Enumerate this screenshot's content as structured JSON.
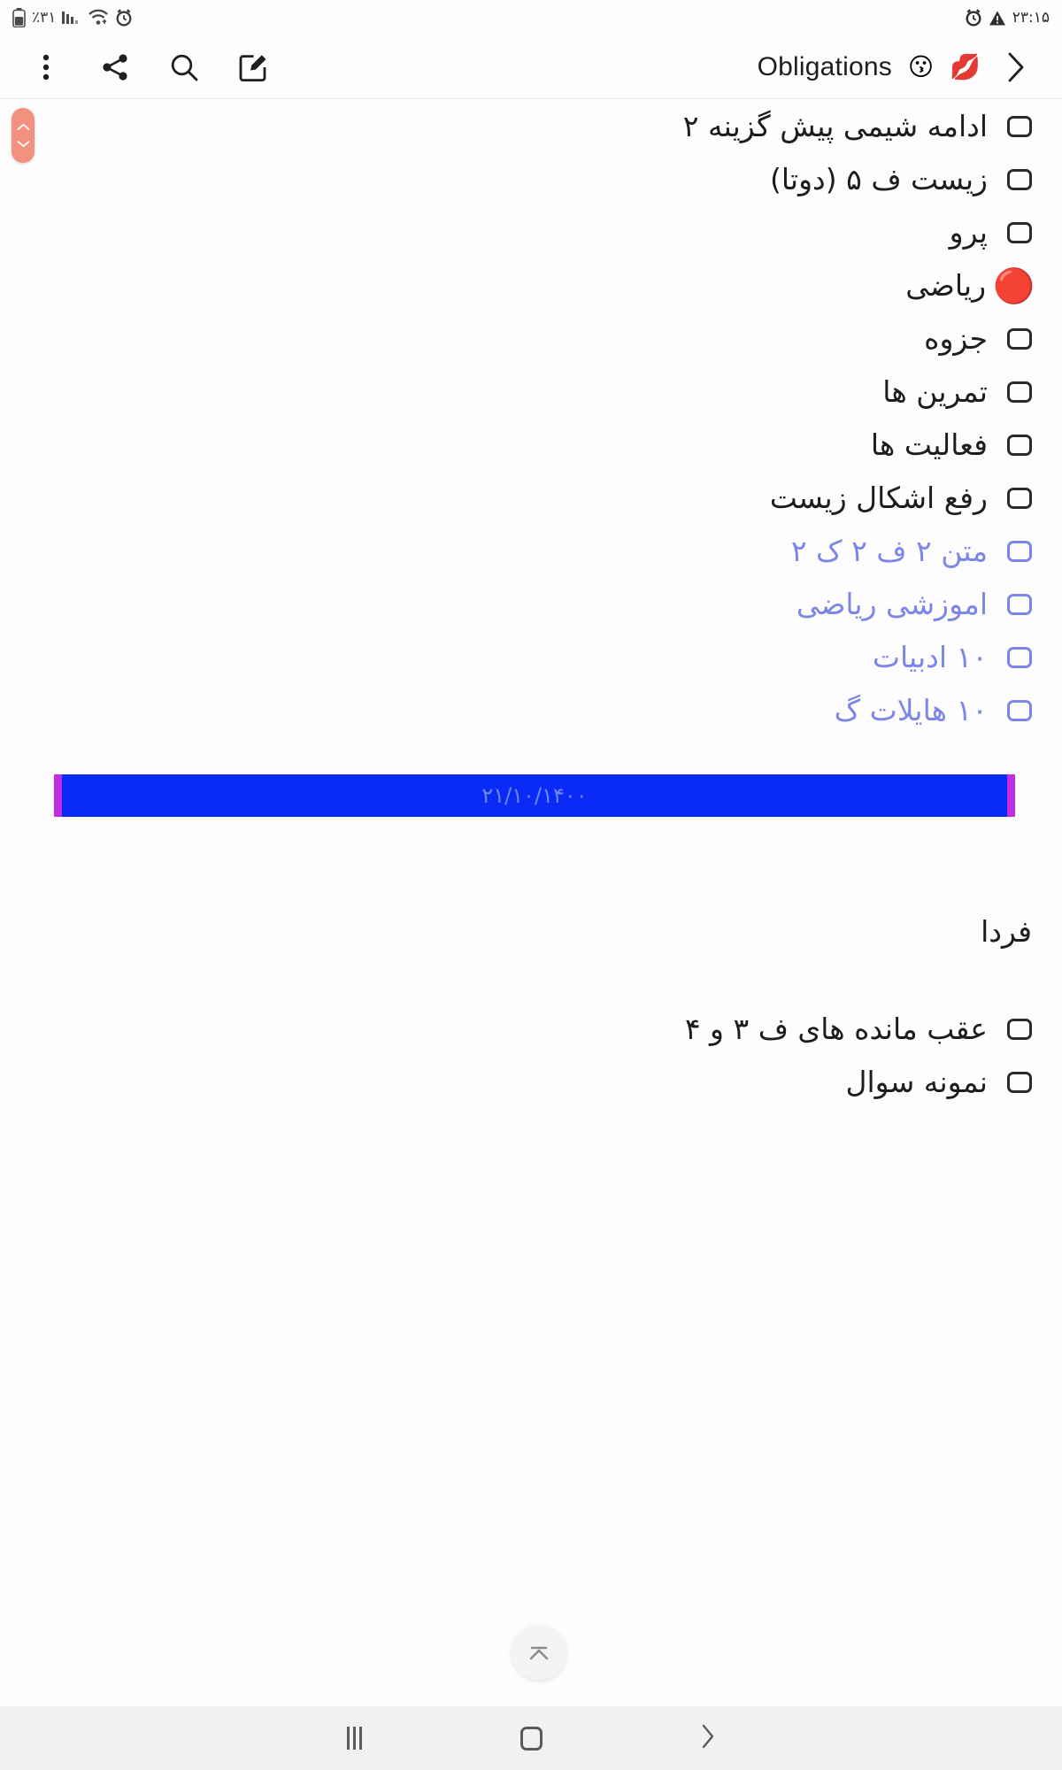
{
  "status_bar": {
    "battery_percent": "٪۳۱",
    "time": "۲۳:۱۵",
    "icons_left": [
      "battery-icon",
      "signal-bars-icon",
      "wifi-icon",
      "alarm-clock-icon"
    ],
    "icons_right": [
      "alarm-clock-icon",
      "warning-triangle-icon"
    ]
  },
  "appbar": {
    "title": "Obligations",
    "title_emoji_1": "😗",
    "title_emoji_2": "💋",
    "icons": [
      "overflow-menu-icon",
      "share-icon",
      "search-icon",
      "edit-icon",
      "chevron-right-icon"
    ]
  },
  "note": {
    "items": [
      {
        "text": "ادامه  شیمی پیش گزینه ۲",
        "marker": "checkbox",
        "color": "dark"
      },
      {
        "text": "زیست ف ۵ (دوتا)",
        "marker": "checkbox",
        "color": "dark"
      },
      {
        "text": "پرو",
        "marker": "checkbox",
        "color": "dark"
      },
      {
        "text": "ریاضی",
        "marker": "emoji",
        "emoji": "🔴",
        "color": "dark"
      },
      {
        "text": "جزوه",
        "marker": "checkbox",
        "color": "dark"
      },
      {
        "text": "تمرین ها",
        "marker": "checkbox",
        "color": "dark"
      },
      {
        "text": "فعالیت ها",
        "marker": "checkbox",
        "color": "dark"
      },
      {
        "text": "رفع اشکال زیست",
        "marker": "checkbox",
        "color": "dark"
      },
      {
        "text": "متن ۲ ف ۲ ک ۲",
        "marker": "checkbox",
        "color": "blue"
      },
      {
        "text": "اموزشی ریاضی",
        "marker": "checkbox",
        "color": "blue"
      },
      {
        "text": "۱۰ ادبیات",
        "marker": "checkbox",
        "color": "blue"
      },
      {
        "text": "۱۰ هایلات  گ",
        "marker": "checkbox",
        "color": "blue"
      }
    ],
    "date_banner": {
      "date": "۲۱/۱۰/۱۴۰۰",
      "background": "#0a2bf7",
      "edge_color": "#c02ce0",
      "text_color": "#6f86ee"
    },
    "section_tomorrow": {
      "heading": "فردا",
      "items": [
        {
          "text": "عقب مانده های ف ۳ و ۴",
          "marker": "checkbox",
          "color": "dark"
        },
        {
          "text": "نمونه سوال",
          "marker": "checkbox",
          "color": "dark"
        }
      ]
    }
  },
  "scroll_thumb": {
    "name": "fast-scroll-handle",
    "color": "#f4907f"
  },
  "fab": {
    "name": "scroll-to-top-button"
  },
  "navbar": {
    "recents_label": "recents-button",
    "home_label": "home-button",
    "back_label": "back-button"
  }
}
